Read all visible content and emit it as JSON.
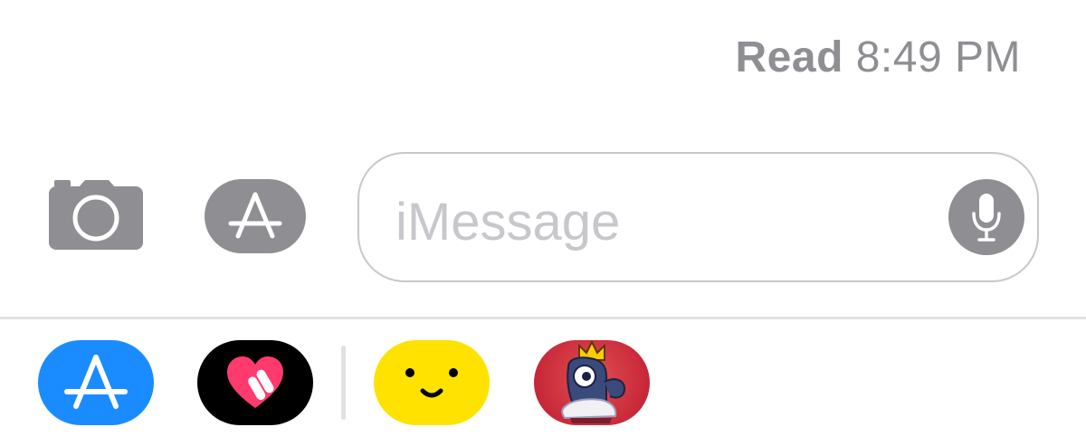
{
  "status": {
    "read_label": "Read",
    "time": "8:49 PM"
  },
  "toolbar": {
    "camera_icon": "camera-icon",
    "apps_icon": "app-store-icon"
  },
  "message_input": {
    "placeholder": "iMessage",
    "value": "",
    "mic_icon": "microphone-icon"
  },
  "app_drawer": {
    "apps": [
      {
        "name": "App Store",
        "icon": "app-store-icon",
        "color": "#1a8cff"
      },
      {
        "name": "Digital Touch",
        "icon": "heart-icon",
        "color": "#000000"
      },
      {
        "name": "Smiley stickers",
        "icon": "smiley-icon",
        "color": "#ffe200"
      },
      {
        "name": "King stickers",
        "icon": "king-sticker-icon",
        "color": "#c92a3a"
      }
    ]
  },
  "colors": {
    "icon_gray": "#8e8e93",
    "border_gray": "#c7c7cc",
    "app_store_blue": "#1a8cff"
  }
}
